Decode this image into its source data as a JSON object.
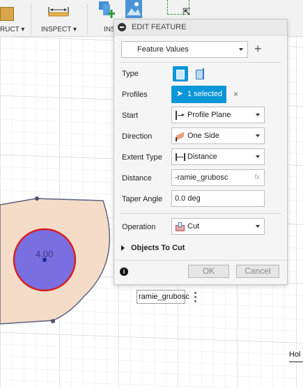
{
  "toolbar": {
    "construct_label": "RUCT",
    "inspect_label": "INSPECT",
    "insert_label": "INS"
  },
  "panel": {
    "title": "EDIT FEATURE",
    "preset": "Feature Values",
    "type_label": "Type",
    "profiles_label": "Profiles",
    "profiles_value": "1 selected",
    "start_label": "Start",
    "start_value": "Profile Plane",
    "direction_label": "Direction",
    "direction_value": "One Side",
    "extent_label": "Extent Type",
    "extent_value": "Distance",
    "distance_label": "Distance",
    "distance_value": "-ramie_grubosc",
    "fx": "fx",
    "taper_label": "Taper Angle",
    "taper_value": "0.0 deg",
    "operation_label": "Operation",
    "operation_value": "Cut",
    "objects_label": "Objects To Cut",
    "ok_label": "OK",
    "cancel_label": "Cancel"
  },
  "canvas": {
    "dimension_text": "4.00",
    "input_value": "ramie_grubosc",
    "corner_text": "Hol"
  },
  "colors": {
    "accent": "#0a96d8",
    "profile_fill": "#f5dcc8",
    "hole_fill": "#7a6fe0",
    "hole_edge": "#d81e1e"
  }
}
